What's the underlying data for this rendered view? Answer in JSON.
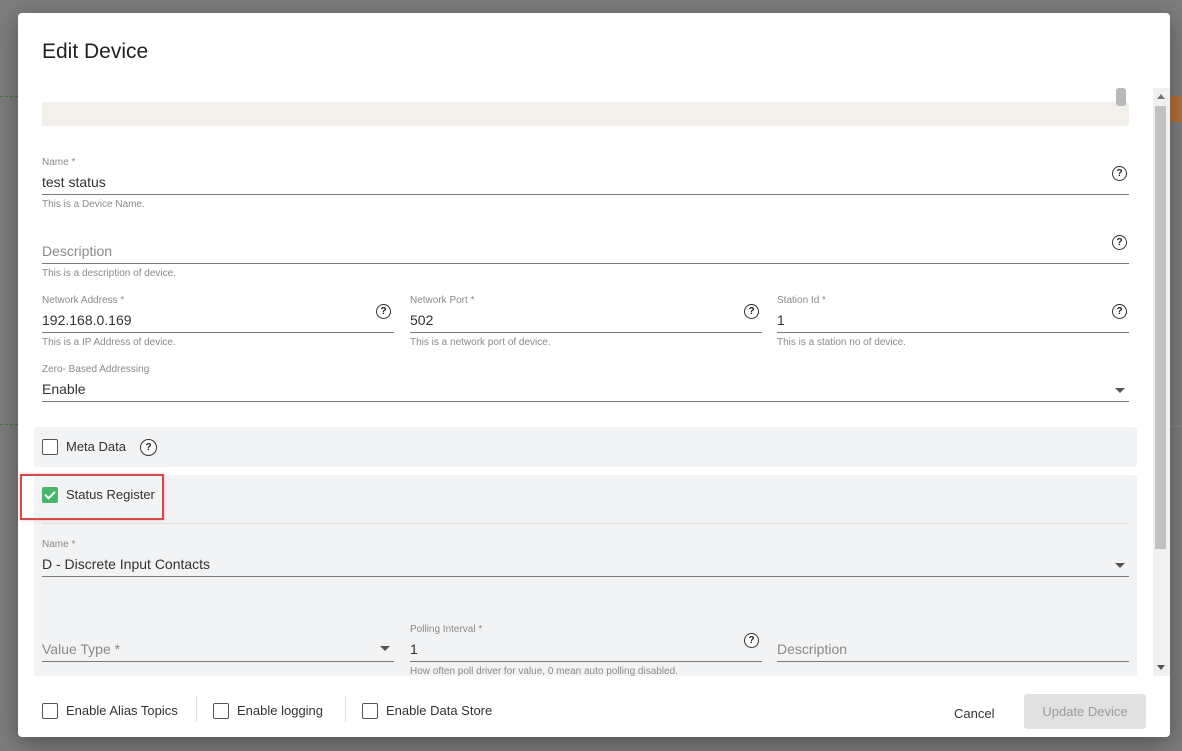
{
  "dialog": {
    "title": "Edit Device"
  },
  "fields": {
    "name": {
      "label": "Name *",
      "value": "test status",
      "hint": "This is a Device Name."
    },
    "description": {
      "placeholder": "Description",
      "hint": "This is a description of device."
    },
    "network_address": {
      "label": "Network Address *",
      "value": "192.168.0.169",
      "hint": "This is a IP Address of device."
    },
    "network_port": {
      "label": "Network Port *",
      "value": "502",
      "hint": "This is a network port of device."
    },
    "station_id": {
      "label": "Station Id *",
      "value": "1",
      "hint": "This is a station no of device."
    },
    "zero_based": {
      "label": "Zero- Based Addressing",
      "value": "Enable"
    }
  },
  "meta_data": {
    "label": "Meta Data",
    "checked": false
  },
  "status_register": {
    "label": "Status Register",
    "checked": true,
    "name": {
      "label": "Name *",
      "value": "D - Discrete Input Contacts"
    },
    "value_type": {
      "placeholder": "Value Type *"
    },
    "polling_interval": {
      "label": "Polling Interval *",
      "value": "1",
      "hint": "How often poll driver for value, 0 mean auto polling disabled."
    },
    "description": {
      "placeholder": "Description"
    }
  },
  "footer": {
    "enable_alias_topics": "Enable Alias Topics",
    "enable_logging": "Enable logging",
    "enable_data_store": "Enable Data Store",
    "cancel": "Cancel",
    "update": "Update Device"
  },
  "colors": {
    "check_green": "#48b56a",
    "highlight_red": "#d64a4a"
  },
  "icons": {
    "help": "help-circle-icon",
    "dropdown": "chevron-down-icon"
  }
}
